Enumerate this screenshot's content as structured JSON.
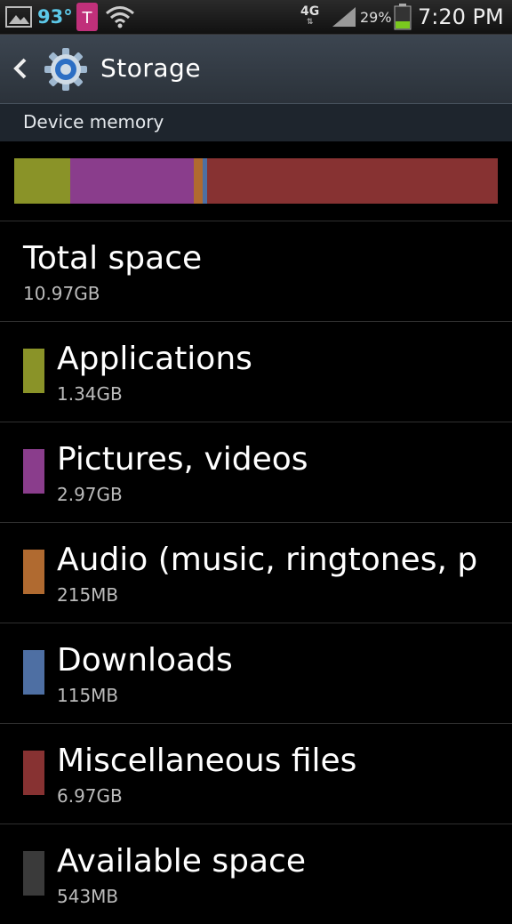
{
  "status_bar": {
    "temperature": "93°",
    "network": "4G",
    "network_arrows": "⇅",
    "battery_percent": "29%",
    "time": "7:20 PM"
  },
  "action_bar": {
    "title": "Storage"
  },
  "section": {
    "header": "Device memory"
  },
  "colors": {
    "applications": "#8a9328",
    "pictures": "#8a3d8c",
    "audio": "#b06a30",
    "downloads": "#4e6fa3",
    "misc": "#873232",
    "available": "#3a3a3a"
  },
  "storage_bar": {
    "total": 10.97,
    "segments": [
      {
        "name": "Applications",
        "gb": 1.34
      },
      {
        "name": "Pictures, videos",
        "gb": 2.97
      },
      {
        "name": "Audio",
        "gb": 0.215
      },
      {
        "name": "Downloads",
        "gb": 0.115
      },
      {
        "name": "Miscellaneous files",
        "gb": 6.97
      }
    ]
  },
  "rows": [
    {
      "label": "Total space",
      "size": "10.97GB"
    },
    {
      "label": "Applications",
      "size": "1.34GB"
    },
    {
      "label": "Pictures, videos",
      "size": "2.97GB"
    },
    {
      "label": "Audio (music, ringtones, p",
      "size": "215MB"
    },
    {
      "label": "Downloads",
      "size": "115MB"
    },
    {
      "label": "Miscellaneous files",
      "size": "6.97GB"
    },
    {
      "label": "Available space",
      "size": "543MB"
    }
  ]
}
